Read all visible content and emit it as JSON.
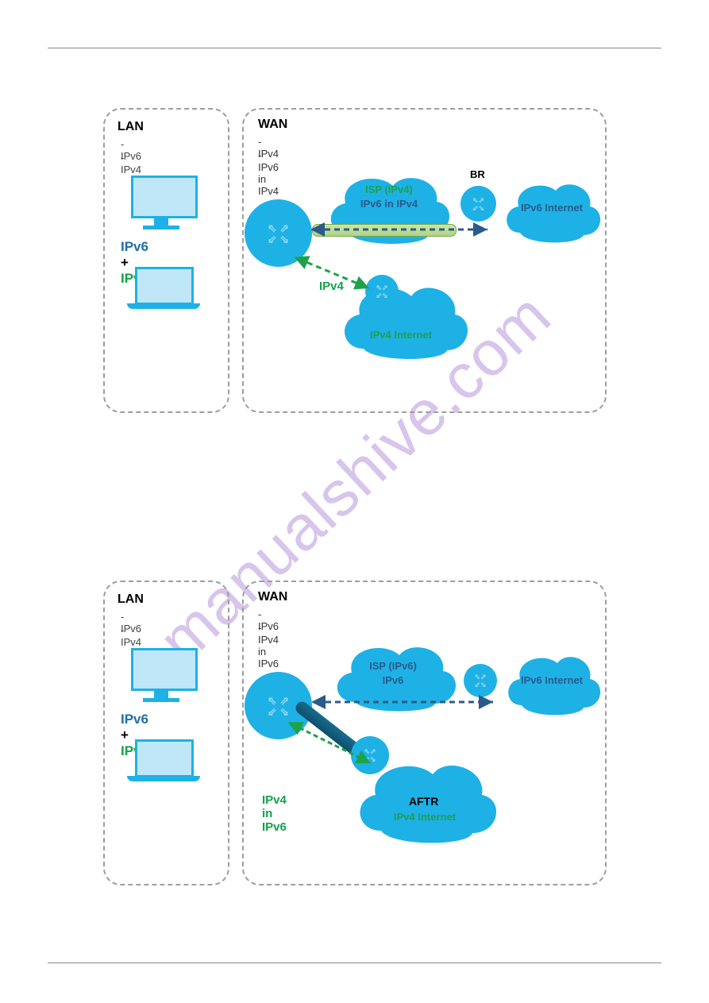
{
  "watermark": "manualshive.com",
  "diagram1": {
    "lan": {
      "title": "LAN",
      "line1": "- IPv6",
      "line2": "- IPv4",
      "combo_a": "IPv6",
      "combo_plus": " + ",
      "combo_b": "IPv4"
    },
    "wan": {
      "title": "WAN",
      "line1": "-IPv4",
      "line2": "-IPv6 in IPv4"
    },
    "cloud_isp_top": "ISP (IPv4)",
    "cloud_isp_sub": "IPv6 in IPv4",
    "br_label": "BR",
    "ipv6_internet": "IPv6 Internet",
    "ipv4_arrow_label": "IPv4",
    "ipv4_internet": "IPv4 Internet"
  },
  "diagram2": {
    "lan": {
      "title": "LAN",
      "line1": "- IPv6",
      "line2": "- IPv4",
      "combo_a": "IPv6",
      "combo_plus": " + ",
      "combo_b": "IPv4"
    },
    "wan": {
      "title": "WAN",
      "line1": "-IPv6",
      "line2": "-IPv4 in IPv6"
    },
    "cloud_isp_top": "ISP (IPv6)",
    "cloud_isp_sub": "IPv6",
    "ipv6_internet": "IPv6 Internet",
    "tunnel_label": "IPv4 in IPv6",
    "aftr_label": "AFTR",
    "ipv4_internet": "IPv4 Internet"
  }
}
